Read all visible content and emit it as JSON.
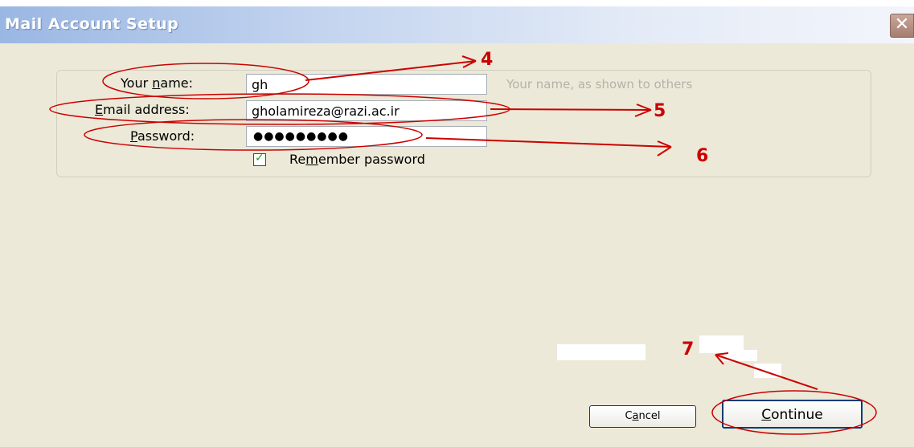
{
  "window": {
    "title": "Mail Account Setup",
    "close_glyph": "✕"
  },
  "form": {
    "name_label_pre": "Your ",
    "name_label_ul": "n",
    "name_label_post": "ame:",
    "name_value": "gh",
    "name_hint": "Your name, as shown to others",
    "email_label_ul": "E",
    "email_label_mid": "mail",
    "email_label_post": " address:",
    "email_value": "gholamireza@razi.ac.ir",
    "password_label_ul": "P",
    "password_label_post": "assword:",
    "password_masked": "●●●●●●●●●",
    "remember_label_pre": "Re",
    "remember_label_ul": "m",
    "remember_label_post": "ember password",
    "remember_checked": true,
    "checkmark_glyph": "✓"
  },
  "buttons": {
    "cancel_pre": "C",
    "cancel_ul": "a",
    "cancel_post": "ncel",
    "continue_ul": "C",
    "continue_post": "ontinue"
  },
  "annotations": {
    "color": "#cc0000",
    "labels": [
      "4",
      "5",
      "6",
      "7"
    ]
  },
  "colors": {
    "dialog_bg": "#ece9d8",
    "title_gradient_start": "#9ab7e3",
    "input_border": "#a5acb5",
    "checkmark": "#21a121"
  }
}
